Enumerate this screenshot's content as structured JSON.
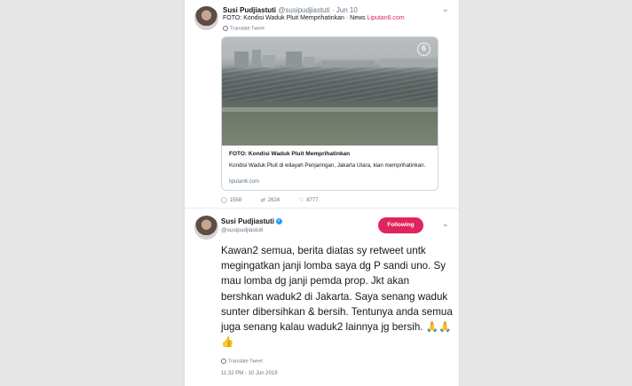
{
  "tweet1": {
    "name": "Susi Pudjiastuti",
    "handle": "@susipudjiastuti",
    "dot": "·",
    "date": "Jun 10",
    "text_main": "FOTO: Kondisi Waduk Pluit Memprihatinkan",
    "text_via": " · News ",
    "text_link": "Liputan6.com",
    "translate": "Translate Tweet",
    "card": {
      "title": "FOTO: Kondisi Waduk Pluit Memprihatinkan",
      "description": "Kondisi Waduk Pluit di wilayah Penjaringan, Jakarta Utara, kian memprihatinkan.",
      "domain": "liputan6.com",
      "watermark": "6"
    },
    "stats": {
      "replies": "1558",
      "retweets": "2624",
      "likes": "8777"
    },
    "icons": [
      "reply-icon",
      "retweet-icon",
      "like-icon",
      "chevron-down-icon"
    ]
  },
  "tweet2": {
    "name": "Susi Pudjiastuti",
    "handle": "@susipudjiastuti",
    "follow_label": "Following",
    "body": "Kawan2 semua, berita diatas sy retweet untk megingatkan janji lomba saya dg P sandi uno. Sy mau lomba dg janji pemda prop. Jkt akan bershkan waduk2 di Jakarta. Saya senang waduk sunter dibersihkan & bersih. Tentunya anda semua juga senang kalau  waduk2 lainnya jg bersih. 🙏🙏👍",
    "translate": "Translate Tweet",
    "timestamp": "11:32 PM - 10 Jun 2019"
  },
  "colors": {
    "accent": "#e0245e",
    "verified": "#1da1f2",
    "muted": "#657786"
  }
}
